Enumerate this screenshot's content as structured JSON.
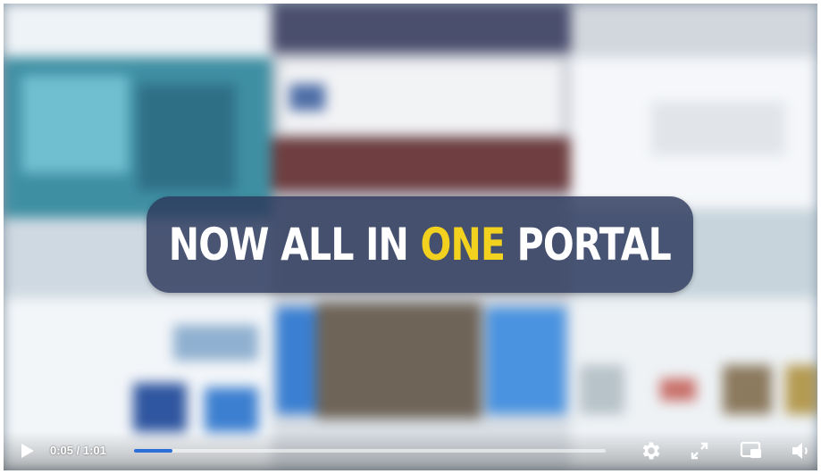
{
  "overlay": {
    "title_part1": "NOW ALL IN ",
    "title_highlight": "ONE",
    "title_part2": " PORTAL",
    "highlight_color": "#f2d21e"
  },
  "controls": {
    "time_display": "0:05 / 1:01",
    "progress": 0.082,
    "icons": {
      "play": "play-icon",
      "settings": "gear-icon",
      "fullscreen": "fullscreen-icon",
      "pip": "picture-in-picture-icon",
      "volume": "volume-icon"
    },
    "progress_color": "#2d6fd8"
  }
}
